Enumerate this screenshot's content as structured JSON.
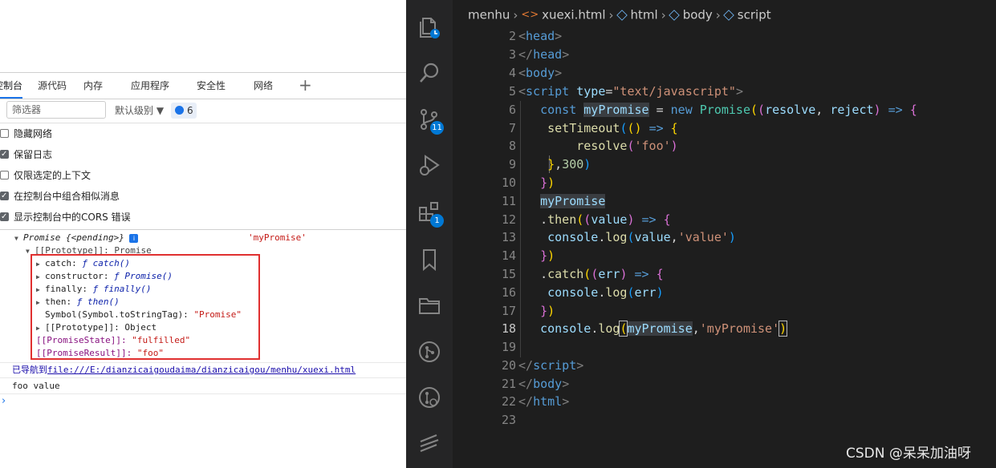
{
  "devtools": {
    "tabs": [
      "控制台",
      "源代码",
      "内存",
      "应用程序",
      "安全性",
      "网络"
    ],
    "add_tab_icon": "plus-icon",
    "filter_placeholder": "筛选器",
    "level_label": "默认级别 ▼",
    "message_count": "6",
    "settings": [
      {
        "label": "隐藏网络",
        "checked": false
      },
      {
        "label": "保留日志",
        "checked": true
      },
      {
        "label": "仅限选定的上下文",
        "checked": false
      },
      {
        "label": "在控制台中组合相似消息",
        "checked": true
      },
      {
        "label": "显示控制台中的CORS 错误",
        "checked": true
      }
    ],
    "console": {
      "promise_header": "Promise {<pending>}",
      "promise_label": "'myPromise'",
      "prototype_line": "[[Prototype]]: Promise",
      "proto_items": [
        {
          "key": "catch:",
          "f": "ƒ",
          "val": "catch()"
        },
        {
          "key": "constructor:",
          "f": "ƒ",
          "val": "Promise()"
        },
        {
          "key": "finally:",
          "f": "ƒ",
          "val": "finally()"
        },
        {
          "key": "then:",
          "f": "ƒ",
          "val": "then()"
        }
      ],
      "tostringtag_key": "Symbol(Symbol.toStringTag):",
      "tostringtag_val": "\"Promise\"",
      "inner_prototype": "[[Prototype]]: Object",
      "state_key": "[[PromiseState]]:",
      "state_val": "\"fulfilled\"",
      "result_key": "[[PromiseResult]]:",
      "result_val": "\"foo\"",
      "nav_prefix": "已导航到",
      "nav_link": "file:///E:/dianzicaigoudaima/dianzicaigou/menhu/xuexi.html",
      "log_output": "foo value",
      "prompt": "›"
    }
  },
  "vscode": {
    "breadcrumb": [
      "menhu",
      "xuexi.html",
      "html",
      "body",
      "script"
    ],
    "activity": [
      {
        "icon": "explorer-icon"
      },
      {
        "icon": "search-icon"
      },
      {
        "icon": "source-control-icon",
        "badge": "11"
      },
      {
        "icon": "run-debug-icon"
      },
      {
        "icon": "extensions-icon",
        "badge": "1"
      },
      {
        "icon": "bookmark-icon"
      },
      {
        "icon": "folder-icon"
      },
      {
        "icon": "git-graph-icon"
      },
      {
        "icon": "git-history-icon"
      },
      {
        "icon": "remote-icon"
      }
    ],
    "line_numbers": [
      "2",
      "3",
      "4",
      "5",
      "6",
      "7",
      "8",
      "9",
      "10",
      "11",
      "12",
      "13",
      "14",
      "15",
      "16",
      "17",
      "18",
      "19",
      "20",
      "21",
      "22",
      "23"
    ],
    "current_line": "18"
  },
  "watermark": "CSDN @呆呆加油呀"
}
